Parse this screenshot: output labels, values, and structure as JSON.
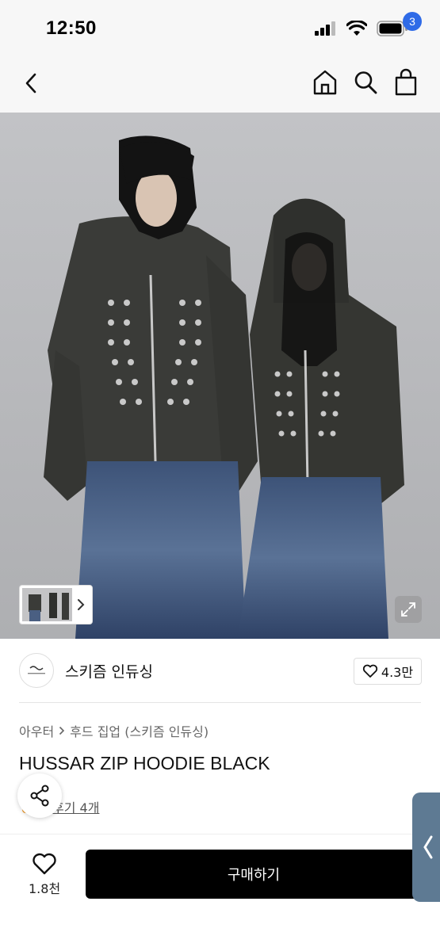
{
  "status": {
    "time": "12:50"
  },
  "nav": {
    "cart_count": "3"
  },
  "brand": {
    "name": "스키즘 인듀싱",
    "likes": "4.3만"
  },
  "product": {
    "breadcrumb": [
      "아우터",
      "후드 집업 (스키즘 인듀싱)"
    ],
    "title": "HUSSAR ZIP HOODIE BLACK",
    "review_link": "후기 4개"
  },
  "bottom": {
    "wish_count": "1.8천",
    "buy_label": "구매하기"
  },
  "colors": {
    "accent": "#2f6be7",
    "buy": "#000000",
    "side_tab": "#5e7a93"
  },
  "icons": [
    "back-icon",
    "home-icon",
    "search-icon",
    "shopping-bag-icon",
    "heart-icon",
    "share-icon",
    "expand-icon",
    "chevron-right-icon",
    "chevron-left-icon"
  ]
}
